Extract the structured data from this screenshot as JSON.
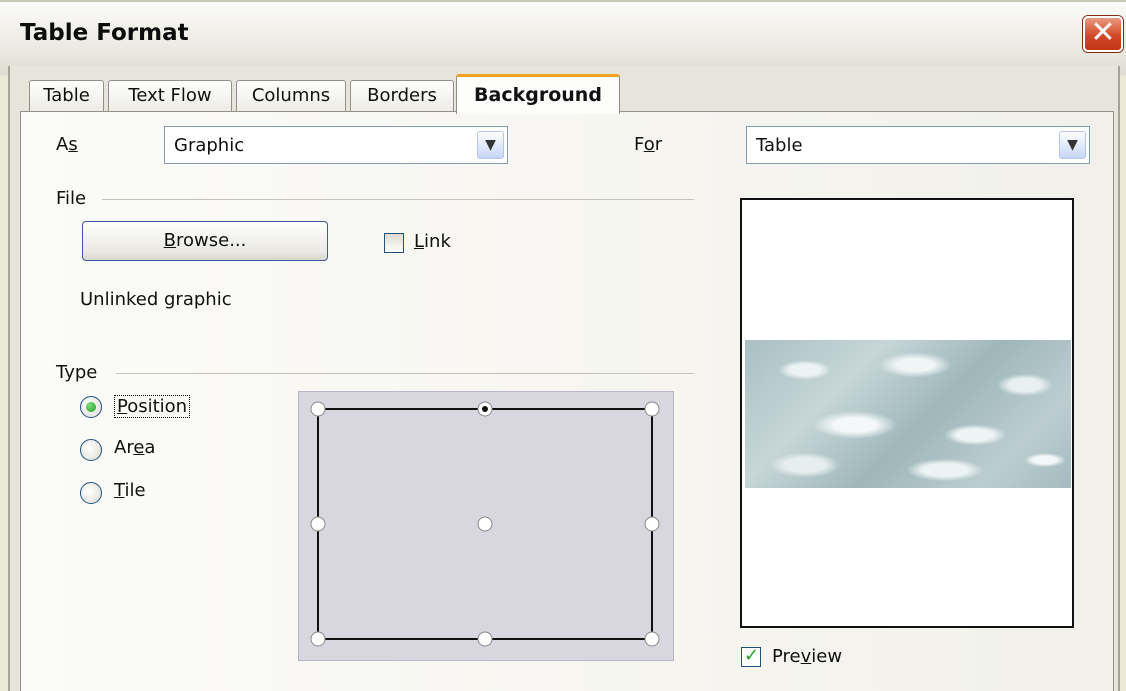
{
  "window": {
    "title": "Table Format",
    "close_symbol": "✕"
  },
  "tabs": [
    {
      "label": "Table"
    },
    {
      "label": "Text Flow"
    },
    {
      "label": "Columns"
    },
    {
      "label": "Borders"
    },
    {
      "label": "Background",
      "active": true
    }
  ],
  "as_row": {
    "label_main": "A",
    "label_mnemonic": "s",
    "value": "Graphic"
  },
  "for_row": {
    "label_main": "F",
    "label_mnemonic": "o",
    "label_rest": "r",
    "value": "Table"
  },
  "file_group": {
    "title": "File",
    "browse_mnemonic": "B",
    "browse_rest": "rowse...",
    "link_mnemonic": "L",
    "link_rest": "ink",
    "link_checked": false,
    "status": "Unlinked graphic"
  },
  "type_group": {
    "title": "Type",
    "options": [
      {
        "pre": "",
        "mn": "P",
        "post": "osition",
        "selected": true
      },
      {
        "pre": "Ar",
        "mn": "e",
        "post": "a",
        "selected": false
      },
      {
        "pre": "",
        "mn": "T",
        "post": "ile",
        "selected": false
      }
    ]
  },
  "preview": {
    "pre": "Pre",
    "mn": "v",
    "post": "iew",
    "checked": true
  },
  "colors": {
    "accent_tab": "#f2a125",
    "check_green": "#21a121",
    "close_red": "#d24a28"
  }
}
